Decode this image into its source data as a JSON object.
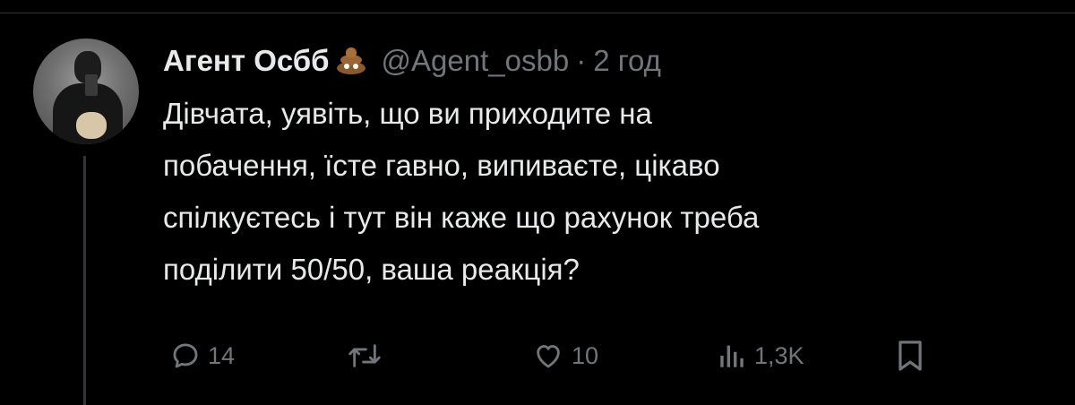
{
  "tweet": {
    "author": {
      "display_name": "Агент Осбб",
      "name_emoji": "poo-emoji",
      "handle": "@Agent_osbb"
    },
    "separator": "·",
    "time": "2 год",
    "text_lines": [
      "Дівчата, уявіть, що ви приходите на",
      "побачення, їсте гавно, випиваєте, цікаво",
      "спілкуєтесь і тут він каже що рахунок треба",
      "поділити 50/50, ваша реакція?"
    ],
    "actions": {
      "reply": {
        "icon": "reply-icon",
        "count": "14"
      },
      "retweet": {
        "icon": "retweet-icon",
        "count": ""
      },
      "like": {
        "icon": "heart-icon",
        "count": "10"
      },
      "views": {
        "icon": "views-icon",
        "count": "1,3K"
      },
      "bookmark": {
        "icon": "bookmark-icon",
        "count": ""
      }
    }
  },
  "colors": {
    "background": "#000000",
    "text_primary": "#e7e9ea",
    "text_secondary": "#71767b",
    "divider": "#2f3336"
  }
}
